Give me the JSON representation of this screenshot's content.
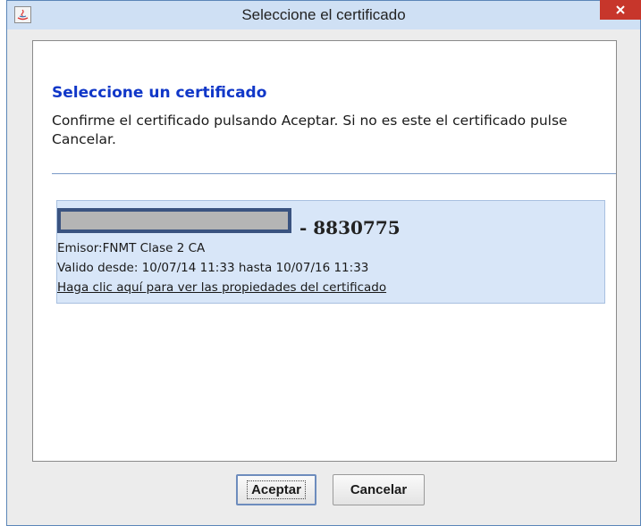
{
  "window": {
    "title": "Seleccione el certificado"
  },
  "dialog": {
    "heading": "Seleccione un certificado",
    "message": "Confirme el certificado pulsando Aceptar. Si no es este el certificado pulse Cancelar."
  },
  "certificate": {
    "name_suffix": "- 8830775",
    "issuer": "Emisor:FNMT Clase 2 CA",
    "validity": "Valido desde: 10/07/14 11:33 hasta 10/07/16 11:33",
    "properties_link": "Haga clic aquí para ver las propiedades del certificado"
  },
  "buttons": {
    "accept_label": "Aceptar",
    "cancel_label": "Cancelar"
  },
  "colors": {
    "heading": "#1037c8",
    "card_background": "#d8e6f8",
    "close_button": "#c7362b"
  }
}
